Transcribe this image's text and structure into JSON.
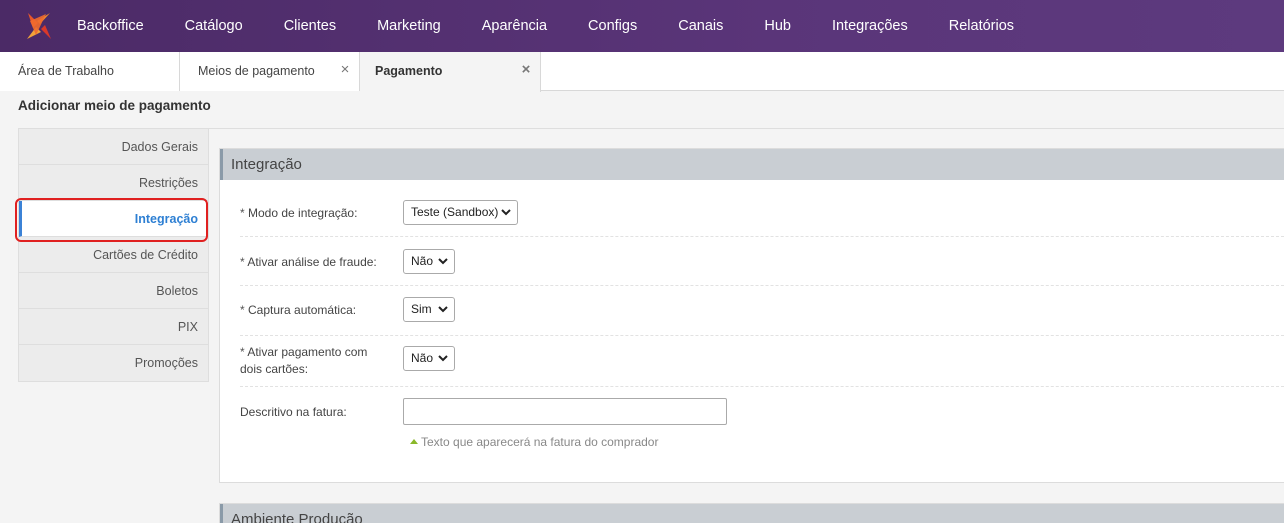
{
  "topbar": {
    "logo": "brand-logo",
    "nav": [
      "Backoffice",
      "Catálogo",
      "Clientes",
      "Marketing",
      "Aparência",
      "Configs",
      "Canais",
      "Hub",
      "Integrações",
      "Relatórios"
    ]
  },
  "tabs": [
    {
      "label": "Área de Trabalho",
      "closable": false
    },
    {
      "label": "Meios de pagamento",
      "closable": true,
      "close": "×"
    },
    {
      "label": "Pagamento",
      "closable": true,
      "active": true,
      "close": "×"
    }
  ],
  "page_title": "Adicionar meio de pagamento",
  "sidebar": {
    "items": [
      "Dados Gerais",
      "Restrições",
      "Integração",
      "Cartões de Crédito",
      "Boletos",
      "PIX",
      "Promoções"
    ],
    "active": "Integração"
  },
  "section": {
    "title": "Integração",
    "fields": {
      "modo": {
        "req": "*",
        "label": "Modo de integração:",
        "value": "Teste (Sandbox)"
      },
      "fraude": {
        "req": "*",
        "label": "Ativar análise de fraude:",
        "value": "Não"
      },
      "captura": {
        "req": "*",
        "label": "Captura automática:",
        "value": "Sim"
      },
      "dois_cartoes": {
        "req": "*",
        "label_line1": "Ativar pagamento com",
        "label_line2": "dois cartões:",
        "value": "Não"
      },
      "descritivo": {
        "label": "Descritivo na fatura:",
        "value": "",
        "hint": "Texto que aparecerá na fatura do comprador"
      }
    }
  },
  "section2": {
    "title": "Ambiente Produção"
  },
  "colors": {
    "topbar": "#5a3579",
    "active_link": "#2d7fd3",
    "highlight": "#e02020"
  }
}
